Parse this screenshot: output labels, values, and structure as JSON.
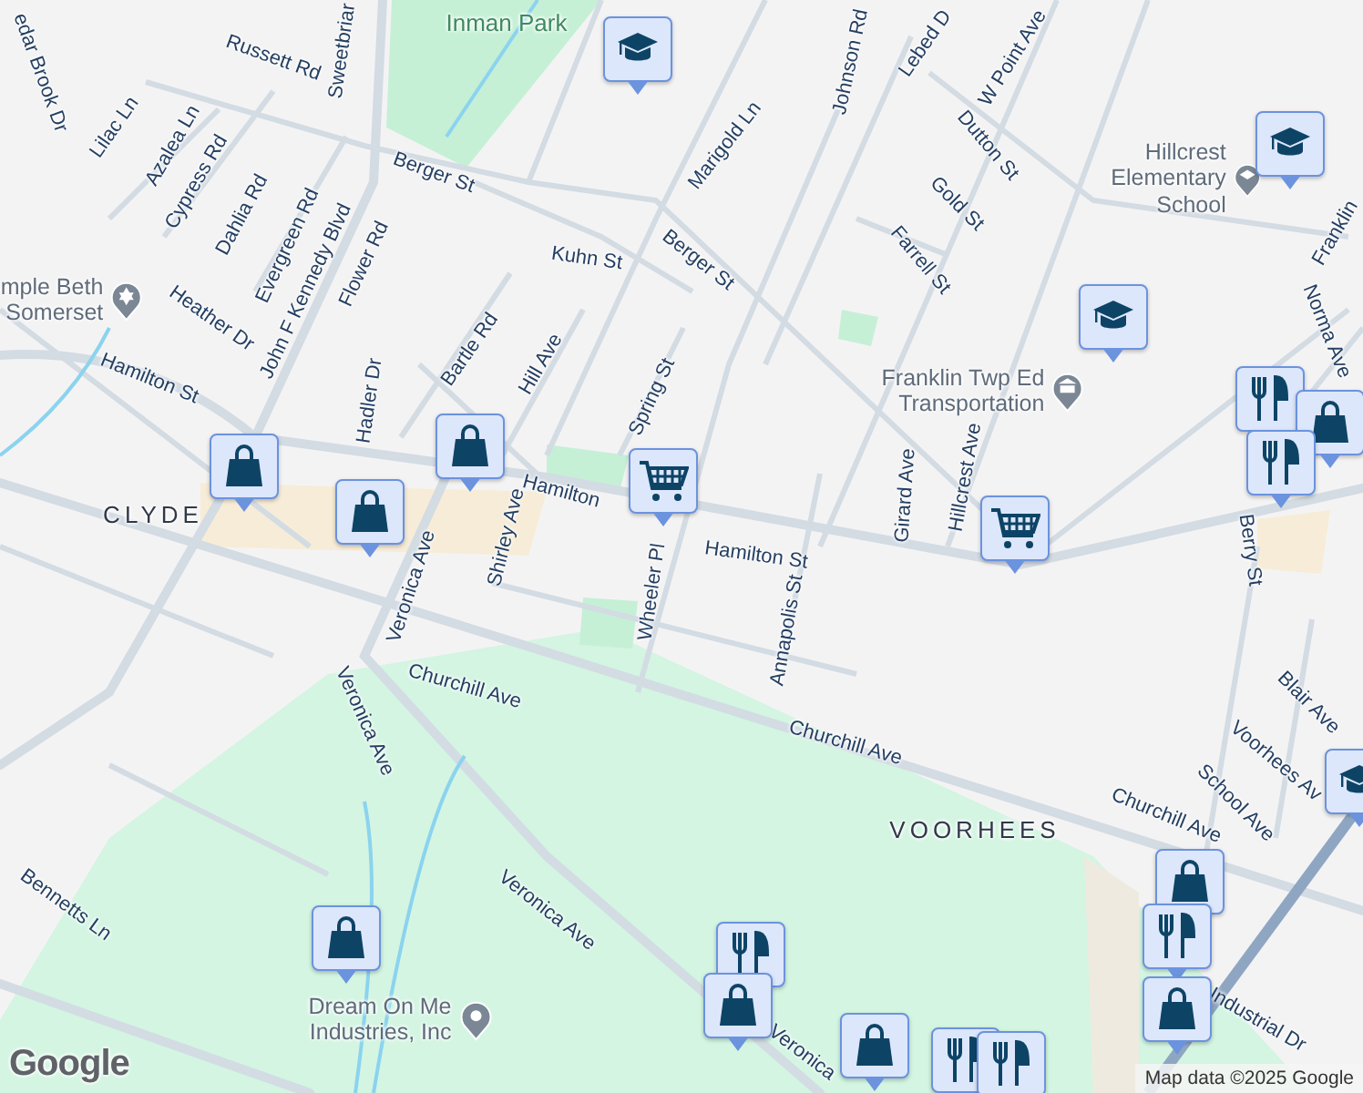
{
  "map": {
    "labels": [
      {
        "kind": "street",
        "text": "edar Brook Dr"
      },
      {
        "kind": "street",
        "text": "Russett Rd"
      },
      {
        "kind": "street",
        "text": "Sweetbriar"
      },
      {
        "kind": "park",
        "text": "Inman Park"
      },
      {
        "kind": "street",
        "text": "Lilac Ln"
      },
      {
        "kind": "street",
        "text": "Azalea Ln"
      },
      {
        "kind": "street",
        "text": "Cypress Rd"
      },
      {
        "kind": "street",
        "text": "Dahlia Rd"
      },
      {
        "kind": "street",
        "text": "Evergreen Rd"
      },
      {
        "kind": "street",
        "text": "John F Kennedy Blvd"
      },
      {
        "kind": "street",
        "text": "Flower Rd"
      },
      {
        "kind": "street",
        "text": "Berger St"
      },
      {
        "kind": "street",
        "text": "Kuhn St"
      },
      {
        "kind": "street",
        "text": "Berger St"
      },
      {
        "kind": "worship",
        "text": "mple Beth\nSomerset"
      },
      {
        "kind": "street",
        "text": "Heather Dr"
      },
      {
        "kind": "street",
        "text": "Hadler Dr"
      },
      {
        "kind": "street",
        "text": "Bartle Rd"
      },
      {
        "kind": "street",
        "text": "Hill Ave"
      },
      {
        "kind": "street",
        "text": "Spring St"
      },
      {
        "kind": "street",
        "text": "Hamilton St"
      },
      {
        "kind": "district",
        "text": "CLYDE"
      },
      {
        "kind": "street",
        "text": "Veronica Ave"
      },
      {
        "kind": "street",
        "text": "Shirley Ave"
      },
      {
        "kind": "street",
        "text": "Hamilton"
      },
      {
        "kind": "street",
        "text": "Hamilton St"
      },
      {
        "kind": "street",
        "text": "Wheeler Pl"
      },
      {
        "kind": "street",
        "text": "Annapolis St"
      },
      {
        "kind": "street",
        "text": "Churchill Ave"
      },
      {
        "kind": "street",
        "text": "Veronica Ave"
      },
      {
        "kind": "street",
        "text": "Churchill Ave"
      },
      {
        "kind": "district",
        "text": "VOORHEES"
      },
      {
        "kind": "street",
        "text": "Veronica Ave"
      },
      {
        "kind": "street",
        "text": "Bennetts Ln"
      },
      {
        "kind": "business",
        "text": "Dream On Me\nIndustries, Inc"
      },
      {
        "kind": "street",
        "text": "Veronica"
      },
      {
        "kind": "street",
        "text": "Marigold Ln"
      },
      {
        "kind": "street",
        "text": "Johnson Rd"
      },
      {
        "kind": "street",
        "text": "Lebed D"
      },
      {
        "kind": "street",
        "text": "W Point Ave"
      },
      {
        "kind": "street",
        "text": "Dutton St"
      },
      {
        "kind": "street",
        "text": "Gold St"
      },
      {
        "kind": "street",
        "text": "Farrell St"
      },
      {
        "kind": "school",
        "text": "Hillcrest\nElementary School"
      },
      {
        "kind": "street",
        "text": "Franklin"
      },
      {
        "kind": "street",
        "text": "Norma Ave"
      },
      {
        "kind": "building",
        "text": "Franklin Twp Ed\nTransportation"
      },
      {
        "kind": "street",
        "text": "Girard Ave"
      },
      {
        "kind": "street",
        "text": "Hillcrest Ave"
      },
      {
        "kind": "street",
        "text": "Berry St"
      },
      {
        "kind": "street",
        "text": "Blair Ave"
      },
      {
        "kind": "street",
        "text": "Voorhees Av"
      },
      {
        "kind": "street",
        "text": "School Ave"
      },
      {
        "kind": "street",
        "text": "Churchill Ave"
      },
      {
        "kind": "street",
        "text": "Industrial Dr"
      }
    ],
    "pins": [
      {
        "kind": "school"
      },
      {
        "kind": "school"
      },
      {
        "kind": "school"
      },
      {
        "kind": "shop"
      },
      {
        "kind": "shop"
      },
      {
        "kind": "shop"
      },
      {
        "kind": "cart"
      },
      {
        "kind": "cart"
      },
      {
        "kind": "food"
      },
      {
        "kind": "shop"
      },
      {
        "kind": "food"
      },
      {
        "kind": "shop"
      },
      {
        "kind": "food"
      },
      {
        "kind": "shop"
      },
      {
        "kind": "shop"
      },
      {
        "kind": "shop"
      },
      {
        "kind": "food"
      },
      {
        "kind": "shop"
      },
      {
        "kind": "food"
      },
      {
        "kind": "food"
      },
      {
        "kind": "school"
      }
    ],
    "logo": "Google",
    "attribution": "Map data ©2025 Google"
  }
}
